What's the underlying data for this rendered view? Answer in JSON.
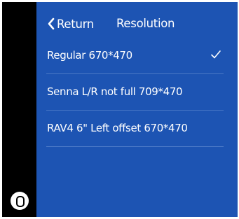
{
  "header": {
    "back_label": "Return",
    "title": "Resolution"
  },
  "options": [
    {
      "label": "Regular 670*470",
      "selected": true
    },
    {
      "label": "Senna L/R not full 709*470",
      "selected": false
    },
    {
      "label": "RAV4 6\" Left offset 670*470",
      "selected": false
    }
  ],
  "icons": {
    "back": "chevron-left-icon",
    "selected": "checkmark-icon",
    "home": "home-button-icon"
  },
  "colors": {
    "screen_background": "#1d54b3",
    "divider": "#4a78c6",
    "rail": "#000000",
    "text": "#ffffff"
  }
}
